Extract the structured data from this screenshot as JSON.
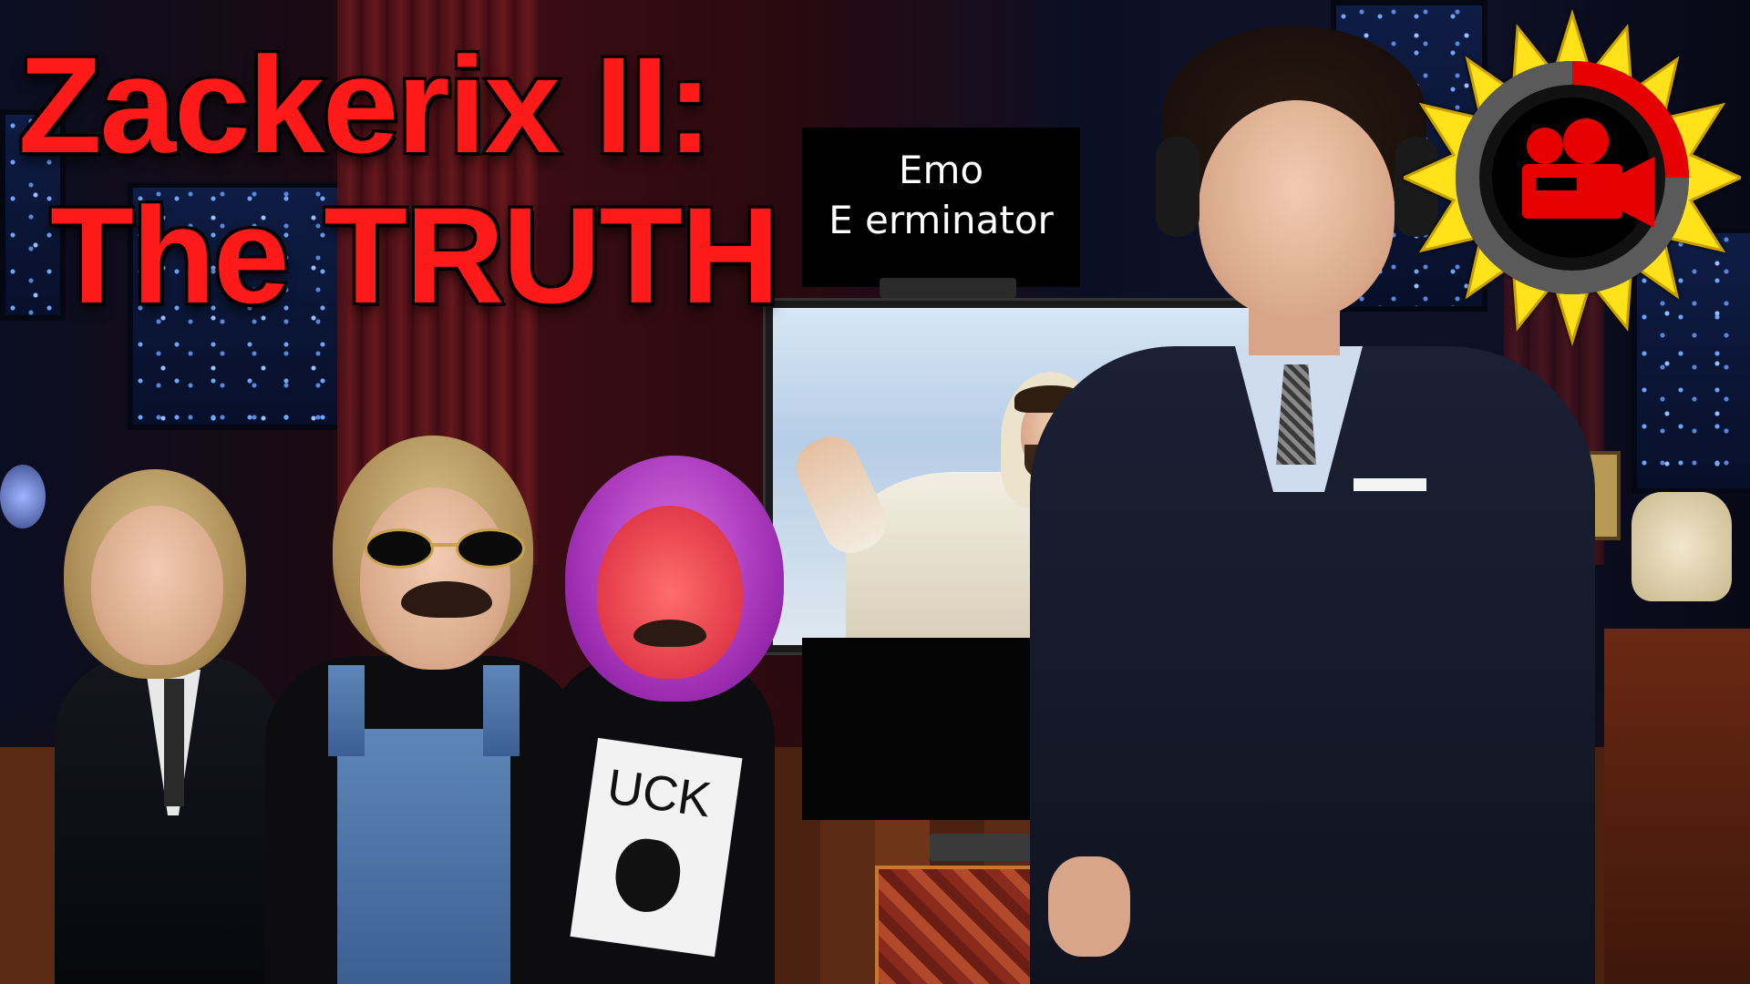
{
  "thumbnail": {
    "title_line1": "Zackerix II:",
    "title_line2": "The TRUTH",
    "sign_line1": "Emo",
    "sign_line2": "E  erminator",
    "shirt_text": "UCK",
    "logo_icon": "film-camera-icon",
    "colors": {
      "title_red": "#ff1a1a",
      "logo_yellow": "#ffe21a",
      "logo_red": "#e60000",
      "logo_gray": "#5a5a5a"
    }
  }
}
